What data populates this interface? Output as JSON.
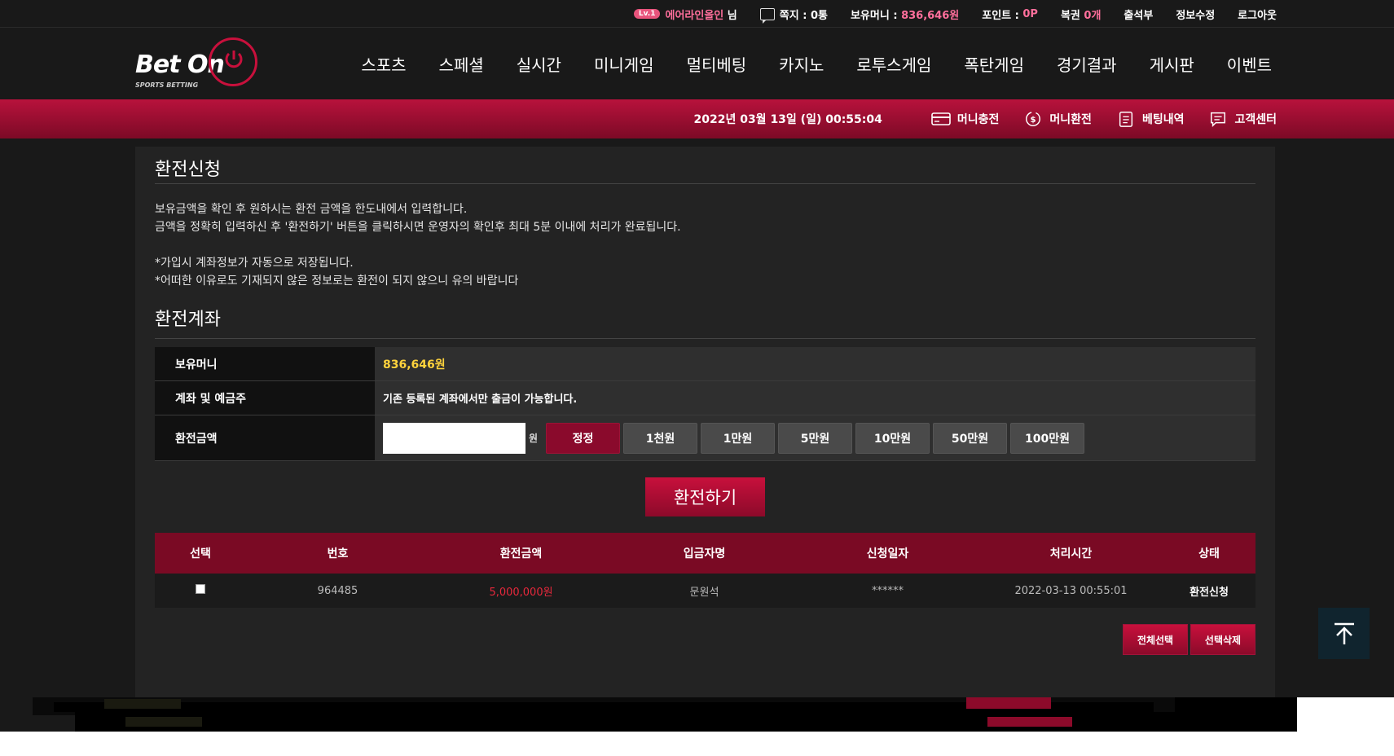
{
  "topbar": {
    "level": "Lv.1",
    "username": "에어라인올인",
    "user_suffix": "님",
    "messages_label": "쪽지 :",
    "messages_value": "0통",
    "balance_label": "보유머니 :",
    "balance_value": "836,646원",
    "points_label": "포인트 :",
    "points_value": "0P",
    "lottery_label": "복권",
    "lottery_value": "0개",
    "attendance": "출석부",
    "profile": "정보수정",
    "logout": "로그아웃"
  },
  "logo": {
    "text": "Bet On",
    "sub": "SPORTS BETTING"
  },
  "nav": [
    "스포츠",
    "스페셜",
    "실시간",
    "미니게임",
    "멀티베팅",
    "카지노",
    "로투스게임",
    "폭탄게임",
    "경기결과",
    "게시판",
    "이벤트"
  ],
  "strip": {
    "datetime": "2022년 03월 13일 (일) 00:55:04",
    "deposit": "머니충전",
    "withdraw": "머니환전",
    "history": "베팅내역",
    "support": "고객센터"
  },
  "section1": {
    "title": "환전신청",
    "lines": [
      "보유금액을 확인 후 원하시는 환전 금액을 한도내에서 입력합니다.",
      "금액을 정확히 입력하신 후 '환전하기' 버튼을 클릭하시면 운영자의 확인후 최대 5분 이내에 처리가 완료됩니다.",
      "",
      "*가입시 계좌정보가 자동으로 저장됩니다.",
      "*어떠한 이유로도 기재되지 않은 정보로는 환전이 되지 않으니 유의 바랍니다"
    ]
  },
  "section2": {
    "title": "환전계좌"
  },
  "form": {
    "balance_label": "보유머니",
    "balance_value": "836,646원",
    "account_label": "계좌 및 예금주",
    "account_value": "기존 등록된 계좌에서만 출금이 가능합니다.",
    "amount_label": "환전금액",
    "amount_value": "",
    "won": "원",
    "buttons": [
      "정정",
      "1천원",
      "1만원",
      "5만원",
      "10만원",
      "50만원",
      "100만원"
    ]
  },
  "submit_label": "환전하기",
  "table": {
    "headers": [
      "선택",
      "번호",
      "환전금액",
      "입금자명",
      "신청일자",
      "처리시간",
      "상태"
    ],
    "rows": [
      {
        "no": "964485",
        "amount": "5,000,000원",
        "name": "문원석",
        "date": "******",
        "processed": "2022-03-13 00:55:01",
        "status": "환전신청"
      }
    ]
  },
  "actions": {
    "select_all": "전체선택",
    "delete_selected": "선택삭제"
  },
  "colors": {
    "accent": "#c8103c",
    "gold": "#ffd33c",
    "amount_red": "#e8283c"
  }
}
